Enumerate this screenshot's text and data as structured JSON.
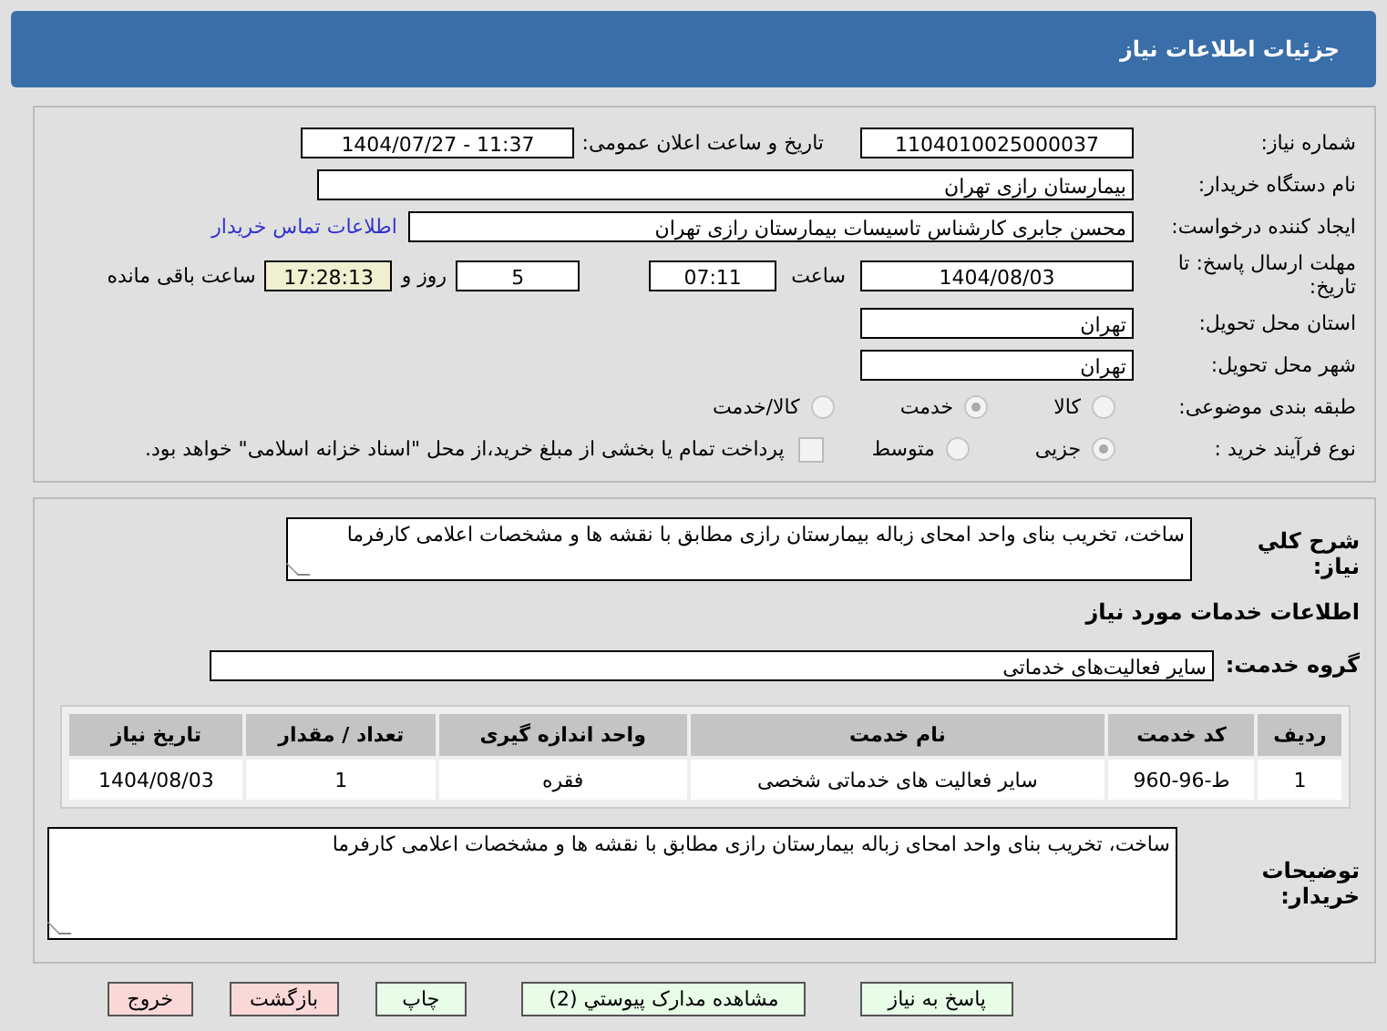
{
  "header": {
    "title": "جزئیات اطلاعات نیاز"
  },
  "form": {
    "need_number": {
      "label": "شماره نیاز:",
      "value": "1104010025000037"
    },
    "announce": {
      "label": "تاریخ و ساعت اعلان عمومی:",
      "value": "1404/07/27 - 11:37"
    },
    "buyer": {
      "label": "نام دستگاه خریدار:",
      "value": "بیمارستان رازی تهران"
    },
    "creator": {
      "label": "ایجاد کننده درخواست:",
      "value": "محسن جابری کارشناس تاسیسات بیمارستان رازی تهران",
      "link": "اطلاعات تماس خریدار"
    },
    "deadline": {
      "label": "مهلت ارسال پاسخ: تا تاریخ:",
      "date": "1404/08/03",
      "time_label": "ساعت",
      "time": "07:11",
      "days": "5",
      "days_label": "روز و",
      "remaining": "17:28:13",
      "remaining_label": "ساعت باقی مانده"
    },
    "province": {
      "label": "استان محل تحویل:",
      "value": "تهران"
    },
    "city": {
      "label": "شهر محل تحویل:",
      "value": "تهران"
    },
    "category": {
      "label": "طبقه بندی موضوعی:",
      "options": [
        {
          "label": "کالا",
          "selected": false
        },
        {
          "label": "خدمت",
          "selected": true
        },
        {
          "label": "کالا/خدمت",
          "selected": false
        }
      ]
    },
    "process": {
      "label": "نوع فرآیند خرید :",
      "options": [
        {
          "label": "جزیی",
          "selected": true
        },
        {
          "label": "متوسط",
          "selected": false
        }
      ],
      "payment": {
        "checked": false,
        "text": "پرداخت تمام یا بخشی از مبلغ خرید،از محل \"اسناد خزانه اسلامی\" خواهد بود."
      }
    }
  },
  "summary": {
    "label": "شرح کلي نياز:",
    "value": "ساخت، تخریب بنای واحد امحای زباله بیمارستان رازی مطابق با نقشه ها و مشخصات اعلامی کارفرما"
  },
  "services_heading": "اطلاعات خدمات مورد نیاز",
  "service_group": {
    "label": "گروه خدمت:",
    "value": "سایر فعالیت‌های خدماتی"
  },
  "table": {
    "columns": [
      "ردیف",
      "کد خدمت",
      "نام خدمت",
      "واحد اندازه گیری",
      "تعداد / مقدار",
      "تاریخ نیاز"
    ],
    "rows": [
      [
        "1",
        "ط-96-960",
        "سایر فعالیت های خدماتی شخصی",
        "فقره",
        "1",
        "1404/08/03"
      ]
    ]
  },
  "buyer_notes": {
    "label": "توضیحات خریدار:",
    "value": "ساخت، تخریب بنای واحد امحای زباله بیمارستان رازی مطابق با نقشه ها و مشخصات اعلامی کارفرما"
  },
  "buttons": [
    {
      "label": "پاسخ به نیاز",
      "kind": "normal"
    },
    {
      "label": "مشاهده مدارک پیوستي (2)",
      "kind": "normal"
    },
    {
      "label": "چاپ",
      "kind": "normal"
    },
    {
      "label": "بازگشت",
      "kind": "danger"
    },
    {
      "label": "خروج",
      "kind": "danger"
    }
  ]
}
